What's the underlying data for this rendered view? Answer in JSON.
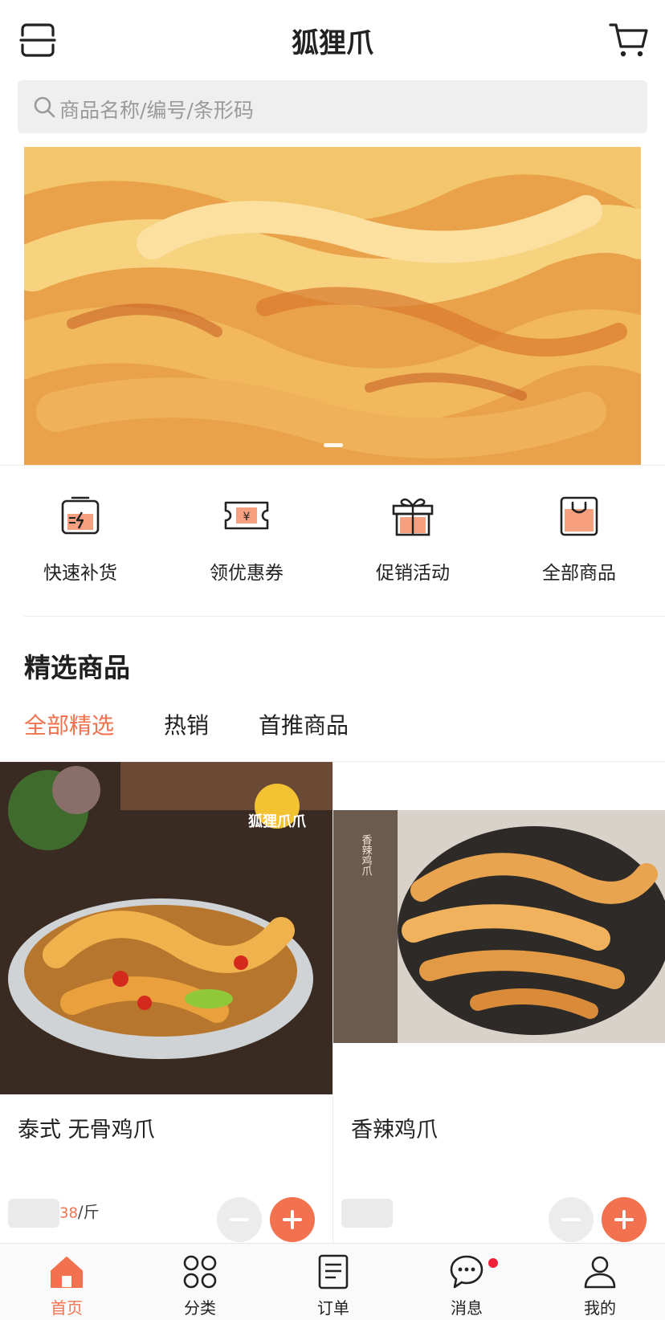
{
  "header": {
    "title": "狐狸爪"
  },
  "search": {
    "placeholder": "商品名称/编号/条形码"
  },
  "quick_menu": [
    {
      "label": "快速补货",
      "icon": "box-lightning-icon"
    },
    {
      "label": "领优惠券",
      "icon": "coupon-yen-icon"
    },
    {
      "label": "促销活动",
      "icon": "gift-box-icon"
    },
    {
      "label": "全部商品",
      "icon": "shopping-bag-icon"
    }
  ],
  "section": {
    "title": "精选商品",
    "tabs": [
      {
        "label": "全部精选",
        "active": true
      },
      {
        "label": "热销",
        "active": false
      },
      {
        "label": "首推商品",
        "active": false
      }
    ]
  },
  "products": [
    {
      "name": "泰式 无骨鸡爪",
      "price_suffix": "38",
      "unit": "/斤",
      "image_watermark": "狐狸爪爪"
    },
    {
      "name": "香辣鸡爪",
      "price_suffix": "",
      "unit": "",
      "image_side_text": "香辣鸡爪"
    }
  ],
  "tabbar": [
    {
      "label": "首页",
      "icon": "home-icon",
      "active": true
    },
    {
      "label": "分类",
      "icon": "category-grid-icon",
      "active": false
    },
    {
      "label": "订单",
      "icon": "order-list-icon",
      "active": false
    },
    {
      "label": "消息",
      "icon": "message-bubble-icon",
      "active": false,
      "badge": true
    },
    {
      "label": "我的",
      "icon": "user-profile-icon",
      "active": false
    }
  ],
  "colors": {
    "accent": "#f2724f",
    "badge": "#f0213a",
    "search_bg": "#efefef"
  }
}
